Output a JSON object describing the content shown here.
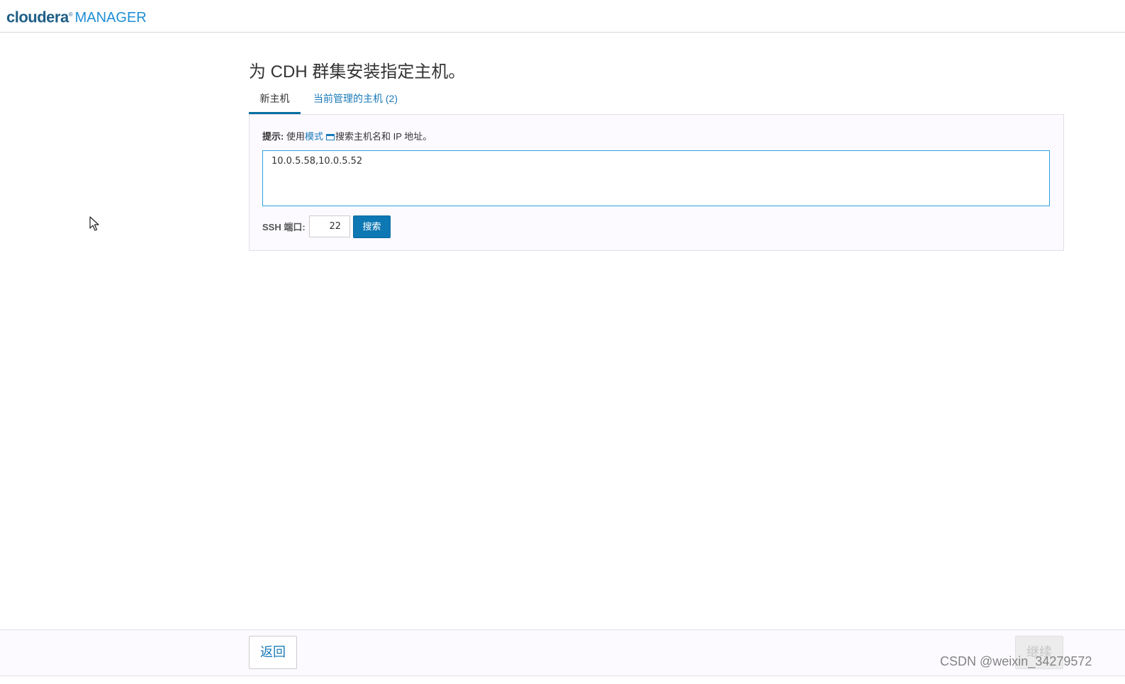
{
  "header": {
    "brand_primary": "cloudera",
    "brand_trademark": "®",
    "brand_secondary": "MANAGER"
  },
  "page": {
    "title": "为 CDH 群集安装指定主机。"
  },
  "tabs": [
    {
      "label": "新主机",
      "active": true
    },
    {
      "label": "当前管理的主机 (2)",
      "active": false
    }
  ],
  "hint": {
    "label": "提示:",
    "before_link": " 使用",
    "link": "模式",
    "after_link": "搜索主机名和 IP 地址。",
    "icon": "window-icon"
  },
  "hosts_input": {
    "value": "10.0.5.58,10.0.5.52"
  },
  "ssh": {
    "label": "SSH 端口:",
    "port": "22",
    "search_label": "搜索"
  },
  "footer": {
    "back_label": "返回",
    "continue_label": "继续"
  },
  "watermark": "CSDN @weixin_34279572",
  "colors": {
    "brand_dark": "#1f5e86",
    "brand_light": "#1e8fd6",
    "primary_button": "#0d78b3",
    "link": "#1a7ab8"
  }
}
